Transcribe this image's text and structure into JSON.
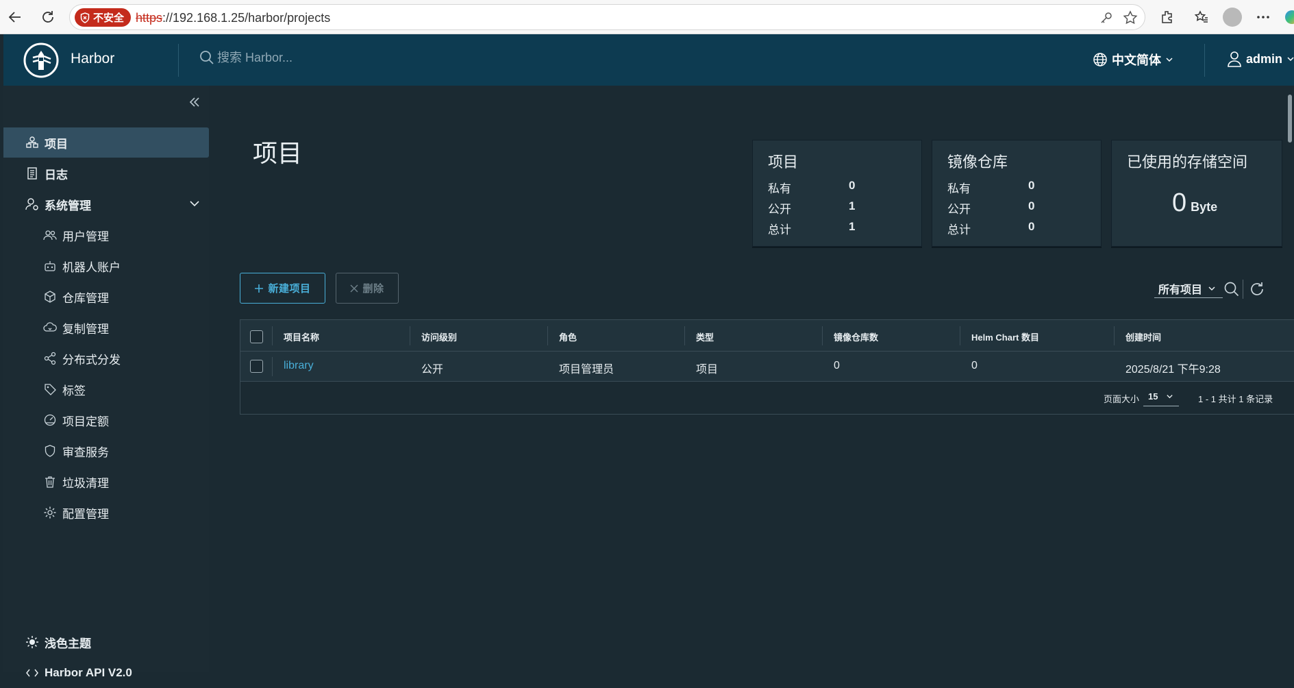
{
  "browser": {
    "insecure_label": "不安全",
    "url_scheme": "https",
    "url_rest": "://192.168.1.25/harbor/projects"
  },
  "header": {
    "brand": "Harbor",
    "search_placeholder": "搜索 Harbor...",
    "language": "中文简体",
    "user": "admin",
    "bg_color": "#0d3b51"
  },
  "sidebar": {
    "items": [
      {
        "label": "项目",
        "icon": "projects-icon",
        "active": true
      },
      {
        "label": "日志",
        "icon": "logs-icon"
      },
      {
        "label": "系统管理",
        "icon": "admin-icon",
        "expanded": true
      }
    ],
    "sub_items": [
      {
        "label": "用户管理",
        "icon": "users-icon"
      },
      {
        "label": "机器人账户",
        "icon": "robot-icon"
      },
      {
        "label": "仓库管理",
        "icon": "registry-icon"
      },
      {
        "label": "复制管理",
        "icon": "replication-icon"
      },
      {
        "label": "分布式分发",
        "icon": "distribution-icon"
      },
      {
        "label": "标签",
        "icon": "tag-icon"
      },
      {
        "label": "项目定额",
        "icon": "quota-icon"
      },
      {
        "label": "审查服务",
        "icon": "shield-icon"
      },
      {
        "label": "垃圾清理",
        "icon": "trash-icon"
      },
      {
        "label": "配置管理",
        "icon": "gear-icon"
      }
    ],
    "theme_label": "浅色主题",
    "api_label": "Harbor API V2.0"
  },
  "main": {
    "title": "项目",
    "cards": {
      "projects": {
        "title": "项目",
        "private_label": "私有",
        "private": "0",
        "public_label": "公开",
        "public": "1",
        "total_label": "总计",
        "total": "1"
      },
      "repos": {
        "title": "镜像仓库",
        "private_label": "私有",
        "private": "0",
        "public_label": "公开",
        "public": "0",
        "total_label": "总计",
        "total": "0"
      },
      "storage": {
        "title": "已使用的存储空间",
        "value": "0",
        "unit": "Byte"
      }
    },
    "buttons": {
      "new_project": "新建项目",
      "delete": "删除"
    },
    "filter": {
      "selected": "所有项目"
    },
    "table": {
      "headers": [
        "项目名称",
        "访问级别",
        "角色",
        "类型",
        "镜像仓库数",
        "Helm Chart 数目",
        "创建时间"
      ],
      "rows": [
        {
          "name": "library",
          "access": "公开",
          "role": "项目管理员",
          "type": "项目",
          "repo_count": "0",
          "chart_count": "0",
          "created": "2025/8/21 下午9:28"
        }
      ],
      "page_size_label": "页面大小",
      "page_size": "15",
      "pagination_info": "1 - 1 共计 1 条记录"
    },
    "accent_color": "#49afd9"
  }
}
